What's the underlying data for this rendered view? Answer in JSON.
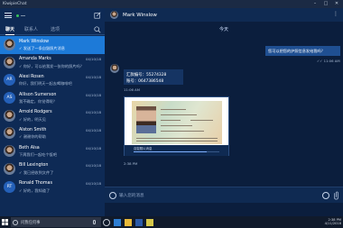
{
  "window": {
    "title": "KiwipieChat"
  },
  "colors": {
    "accent": "#1d7ad8",
    "sidebar_bg": "#0e2a55",
    "main_bg": "#0b1e3d",
    "online": "#37c25a"
  },
  "sidebar": {
    "tabs": [
      {
        "label": "聊天"
      },
      {
        "label": "联系人"
      },
      {
        "label": "选项"
      }
    ],
    "chats": [
      {
        "name": "Mark Winslow",
        "time": "",
        "preview": "✓ 发送了一条自毁照片消息",
        "avatar": "photo"
      },
      {
        "name": "Amanda Marks",
        "time": "04/10/18",
        "preview": "✓ 你好，可以给我发一张你的照片吗？",
        "avatar": "AM"
      },
      {
        "name": "Alexi Rosen",
        "time": "04/10/18",
        "preview": "你好，我们明天一起去喝咖啡吧",
        "avatar": "AR"
      },
      {
        "name": "Allison Sumerson",
        "time": "04/10/18",
        "preview": "我不确定，你觉得呢？",
        "avatar": "AS"
      },
      {
        "name": "Arnold Rodgers",
        "time": "04/10/18",
        "preview": "✓ 好的，明天见",
        "avatar": "AR"
      },
      {
        "name": "Alston Smith",
        "time": "04/10/18",
        "preview": "✓ 谢谢你的帮助",
        "avatar": "AS"
      },
      {
        "name": "Beth Alsa",
        "time": "04/10/18",
        "preview": "下周我们一起吃个饭吧",
        "avatar": "BA"
      },
      {
        "name": "Bill Lexington",
        "time": "04/10/18",
        "preview": "✓ 我已经收到文件了",
        "avatar": "BL"
      },
      {
        "name": "Ronald Thomas",
        "time": "04/10/18",
        "preview": "✓ 好的，我知道了",
        "avatar": "RT"
      }
    ]
  },
  "conversation": {
    "contact_name": "Mark Winslow",
    "day_separator": "今天",
    "outgoing": {
      "text": "您可以把您的护照信息发给我吗？",
      "meta": "✓✓ 11:06 AM"
    },
    "incoming_text": {
      "line1": "汇款编号：55274328",
      "line2": "账号：0647386548",
      "time": "11:06 AM"
    },
    "photo_card": {
      "caption": "自毁照片消息",
      "progress": 0.85,
      "time": "2:38 PM"
    },
    "composer_placeholder": "输入您的消息"
  },
  "taskbar": {
    "search_placeholder": "问我任何事",
    "time": "2:38 PM",
    "date": "4/11/2018"
  }
}
